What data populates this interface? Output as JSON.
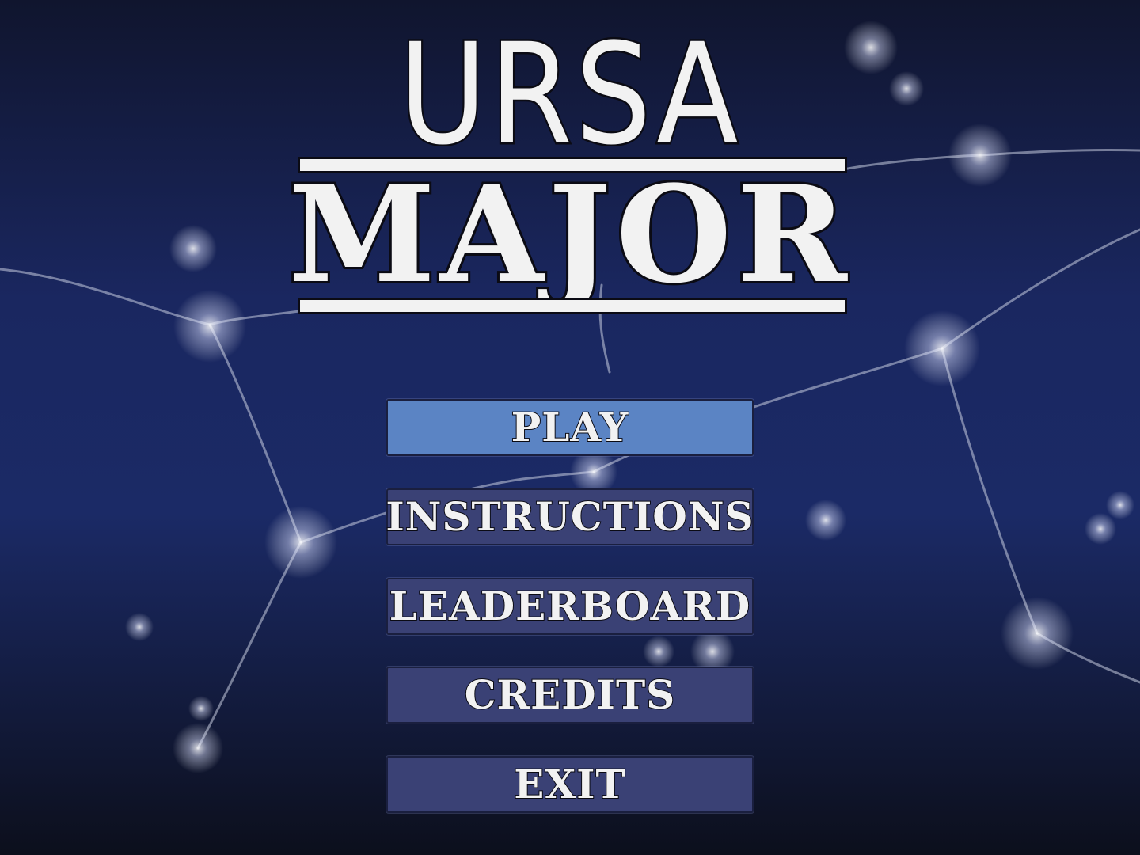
{
  "title": {
    "line1": "URSA",
    "line2": "MAJOR"
  },
  "menu": [
    {
      "label": "PLAY",
      "selected": true
    },
    {
      "label": "INSTRUCTIONS",
      "selected": false
    },
    {
      "label": "LEADERBOARD",
      "selected": false
    },
    {
      "label": "CREDITS",
      "selected": false
    },
    {
      "label": "EXIT",
      "selected": false
    }
  ],
  "colors": {
    "background_top": "#0f1530",
    "background_mid": "#1b2a66",
    "background_bottom": "#0c0f1c",
    "button": "#3a4175",
    "button_selected": "#5b84c4",
    "text": "#f2f2f2",
    "outline": "#0b0b14"
  }
}
